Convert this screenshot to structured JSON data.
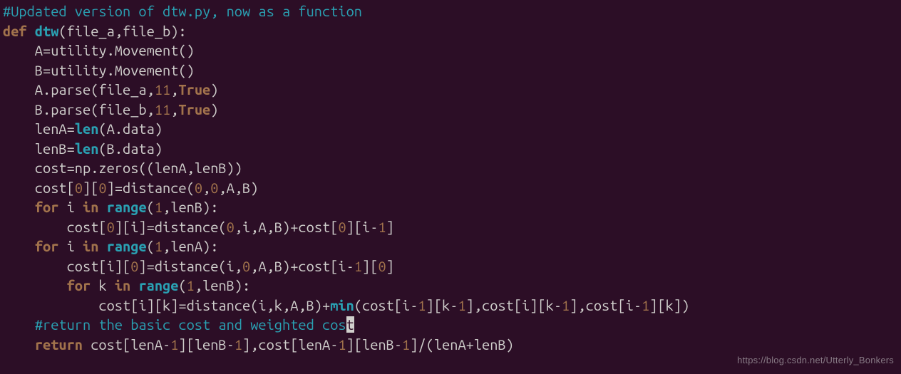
{
  "watermark": "https://blog.csdn.net/Utterly_Bonkers",
  "code": {
    "l1": {
      "t1": "#Updated version of dtw.py, now as a function"
    },
    "l2": {
      "t1": "def ",
      "t2": "dtw",
      "t3": "(file_a,file_b):"
    },
    "l3": {
      "t1": "    A=utility.Movement()"
    },
    "l4": {
      "t1": "    B=utility.Movement()"
    },
    "l5": {
      "t1": "    A.parse(file_a,",
      "t2": "11",
      "t3": ",",
      "t4": "True",
      "t5": ")"
    },
    "l6": {
      "t1": "    B.parse(file_b,",
      "t2": "11",
      "t3": ",",
      "t4": "True",
      "t5": ")"
    },
    "l7": {
      "t1": "    lenA=",
      "t2": "len",
      "t3": "(A.data)"
    },
    "l8": {
      "t1": "    lenB=",
      "t2": "len",
      "t3": "(B.data)"
    },
    "l9": {
      "t1": "    cost=np.zeros((lenA,lenB))"
    },
    "l10": {
      "t1": "    cost[",
      "t2": "0",
      "t3": "][",
      "t4": "0",
      "t5": "]=distance(",
      "t6": "0",
      "t7": ",",
      "t8": "0",
      "t9": ",A,B)"
    },
    "l11": {
      "t1": "    ",
      "t2": "for",
      "t3": " i ",
      "t4": "in",
      "t5": " ",
      "t6": "range",
      "t7": "(",
      "t8": "1",
      "t9": ",lenB):"
    },
    "l12": {
      "t1": "        cost[",
      "t2": "0",
      "t3": "][i]=distance(",
      "t4": "0",
      "t5": ",i,A,B)+cost[",
      "t6": "0",
      "t7": "][i-",
      "t8": "1",
      "t9": "]"
    },
    "l13": {
      "t1": "    ",
      "t2": "for",
      "t3": " i ",
      "t4": "in",
      "t5": " ",
      "t6": "range",
      "t7": "(",
      "t8": "1",
      "t9": ",lenA):"
    },
    "l14": {
      "t1": "        cost[i][",
      "t2": "0",
      "t3": "]=distance(i,",
      "t4": "0",
      "t5": ",A,B)+cost[i-",
      "t6": "1",
      "t7": "][",
      "t8": "0",
      "t9": "]"
    },
    "l15": {
      "t1": "        ",
      "t2": "for",
      "t3": " k ",
      "t4": "in",
      "t5": " ",
      "t6": "range",
      "t7": "(",
      "t8": "1",
      "t9": ",lenB):"
    },
    "l16": {
      "t1": "            cost[i][k]=distance(i,k,A,B)+",
      "t2": "min",
      "t3": "(cost[i-",
      "t4": "1",
      "t5": "][k-",
      "t6": "1",
      "t7": "],cost[i][k-",
      "t8": "1",
      "t9": "],cost[i-",
      "t10": "1",
      "t11": "][k])"
    },
    "l17": {
      "t1": "    ",
      "t2": "#return the basic cost and weighted cos",
      "t3": "t"
    },
    "l18": {
      "t1": "    ",
      "t2": "return",
      "t3": " cost[lenA-",
      "t4": "1",
      "t5": "][lenB-",
      "t6": "1",
      "t7": "],cost[lenA-",
      "t8": "1",
      "t9": "][lenB-",
      "t10": "1",
      "t11": "]/(lenA+lenB)"
    }
  }
}
